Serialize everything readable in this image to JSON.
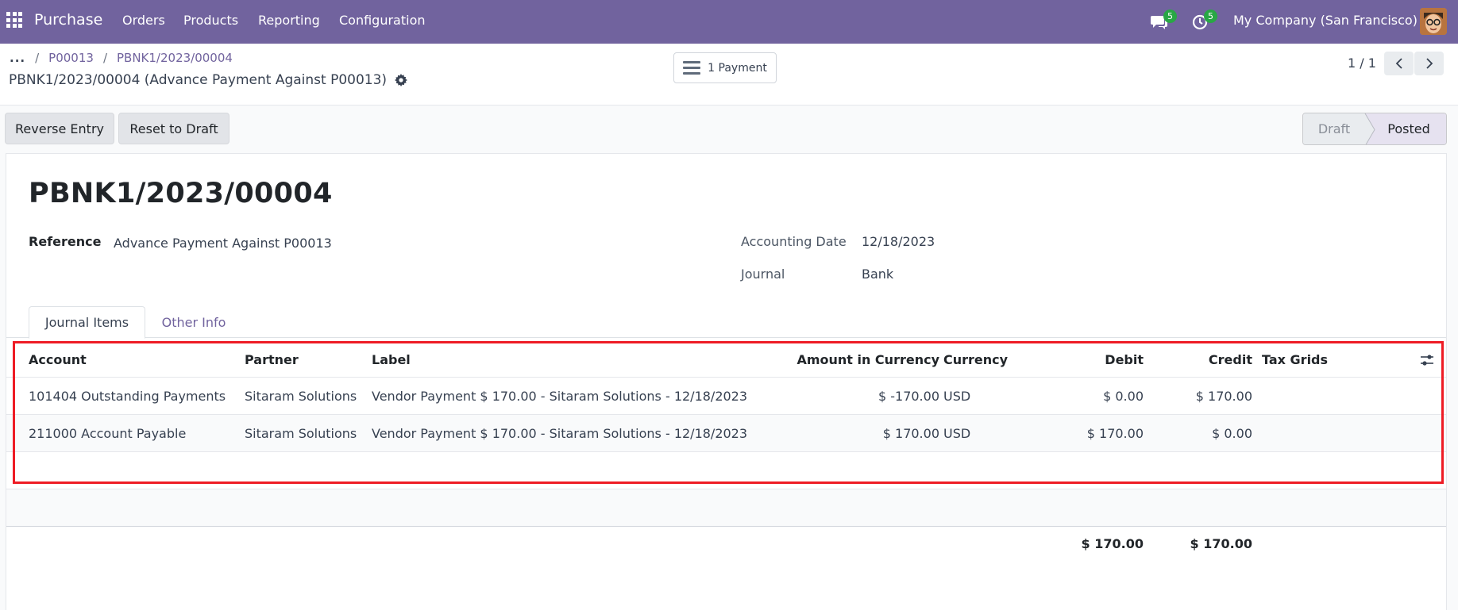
{
  "navbar": {
    "brand": "Purchase",
    "menu": [
      "Orders",
      "Products",
      "Reporting",
      "Configuration"
    ],
    "messages_count": "5",
    "activities_count": "5",
    "company": "My Company (San Francisco)"
  },
  "breadcrumb": {
    "more": "...",
    "items": [
      "P00013",
      "PBNK1/2023/00004"
    ]
  },
  "record": {
    "subtitle": "PBNK1/2023/00004 (Advance Payment Against P00013)",
    "smart_button": "1 Payment",
    "pager": "1 / 1"
  },
  "actions": {
    "reverse": "Reverse Entry",
    "reset": "Reset to Draft"
  },
  "status": {
    "draft": "Draft",
    "posted": "Posted"
  },
  "form": {
    "title": "PBNK1/2023/00004",
    "reference_label": "Reference",
    "reference_value": "Advance Payment Against P00013",
    "date_label": "Accounting Date",
    "date_value": "12/18/2023",
    "journal_label": "Journal",
    "journal_value": "Bank"
  },
  "tabs": [
    "Journal Items",
    "Other Info"
  ],
  "table": {
    "headers": {
      "account": "Account",
      "partner": "Partner",
      "label": "Label",
      "amount": "Amount in Currency",
      "currency": "Currency",
      "debit": "Debit",
      "credit": "Credit",
      "tax": "Tax Grids"
    },
    "rows": [
      {
        "account": "101404 Outstanding Payments",
        "partner": "Sitaram Solutions",
        "label": "Vendor Payment $ 170.00 - Sitaram Solutions - 12/18/2023",
        "amount": "$ -170.00",
        "currency": "USD",
        "debit": "$ 0.00",
        "credit": "$ 170.00"
      },
      {
        "account": "211000 Account Payable",
        "partner": "Sitaram Solutions",
        "label": "Vendor Payment $ 170.00 - Sitaram Solutions - 12/18/2023",
        "amount": "$ 170.00",
        "currency": "USD",
        "debit": "$ 170.00",
        "credit": "$ 0.00"
      }
    ],
    "totals": {
      "debit": "$ 170.00",
      "credit": "$ 170.00"
    }
  },
  "colors": {
    "navbar": "#71639e",
    "link": "#71639e",
    "highlight": "#ee1c25",
    "badge": "#28a745"
  }
}
